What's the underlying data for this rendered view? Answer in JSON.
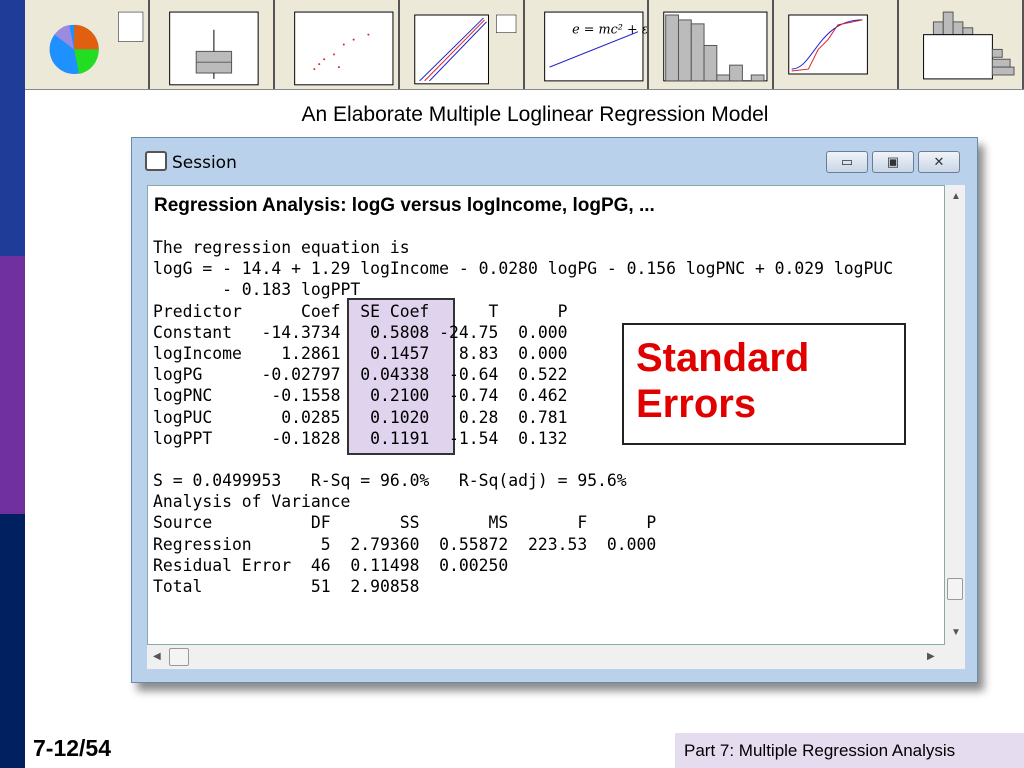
{
  "colors": {
    "sidebar_top": "#1f3c99",
    "sidebar_mid": "#7030a0",
    "sidebar_bottom": "#002060",
    "callout_text": "#e00000",
    "highlight": "#e0d3ee"
  },
  "thumbnail_equation": "e = mc² + ε",
  "slide": {
    "title": "An Elaborate Multiple Loglinear Regression Model",
    "number": "7-12/54",
    "footer": "Part 7: Multiple Regression Analysis"
  },
  "window": {
    "title": "Session",
    "minimize": "▭",
    "maximize": "▣",
    "close": "✕"
  },
  "session": {
    "heading": "Regression Analysis: logG versus logIncome, logPG, ...",
    "lines": [
      "The regression equation is",
      "logG = - 14.4 + 1.29 logIncome - 0.0280 logPG - 0.156 logPNC + 0.029 logPUC",
      "       - 0.183 logPPT",
      "Predictor      Coef  SE Coef      T      P",
      "Constant   -14.3734   0.5808 -24.75  0.000",
      "logIncome    1.2861   0.1457   8.83  0.000",
      "logPG      -0.02797  0.04338  -0.64  0.522",
      "logPNC      -0.1558   0.2100  -0.74  0.462",
      "logPUC       0.0285   0.1020   0.28  0.781",
      "logPPT      -0.1828   0.1191  -1.54  0.132",
      "",
      "S = 0.0499953   R-Sq = 96.0%   R-Sq(adj) = 95.6%",
      "Analysis of Variance",
      "Source          DF       SS       MS       F      P",
      "Regression       5  2.79360  0.55872  223.53  0.000",
      "Residual Error  46  0.11498  0.00250",
      "Total           51  2.90858"
    ]
  },
  "callout": {
    "line1": "Standard",
    "line2": "Errors"
  }
}
